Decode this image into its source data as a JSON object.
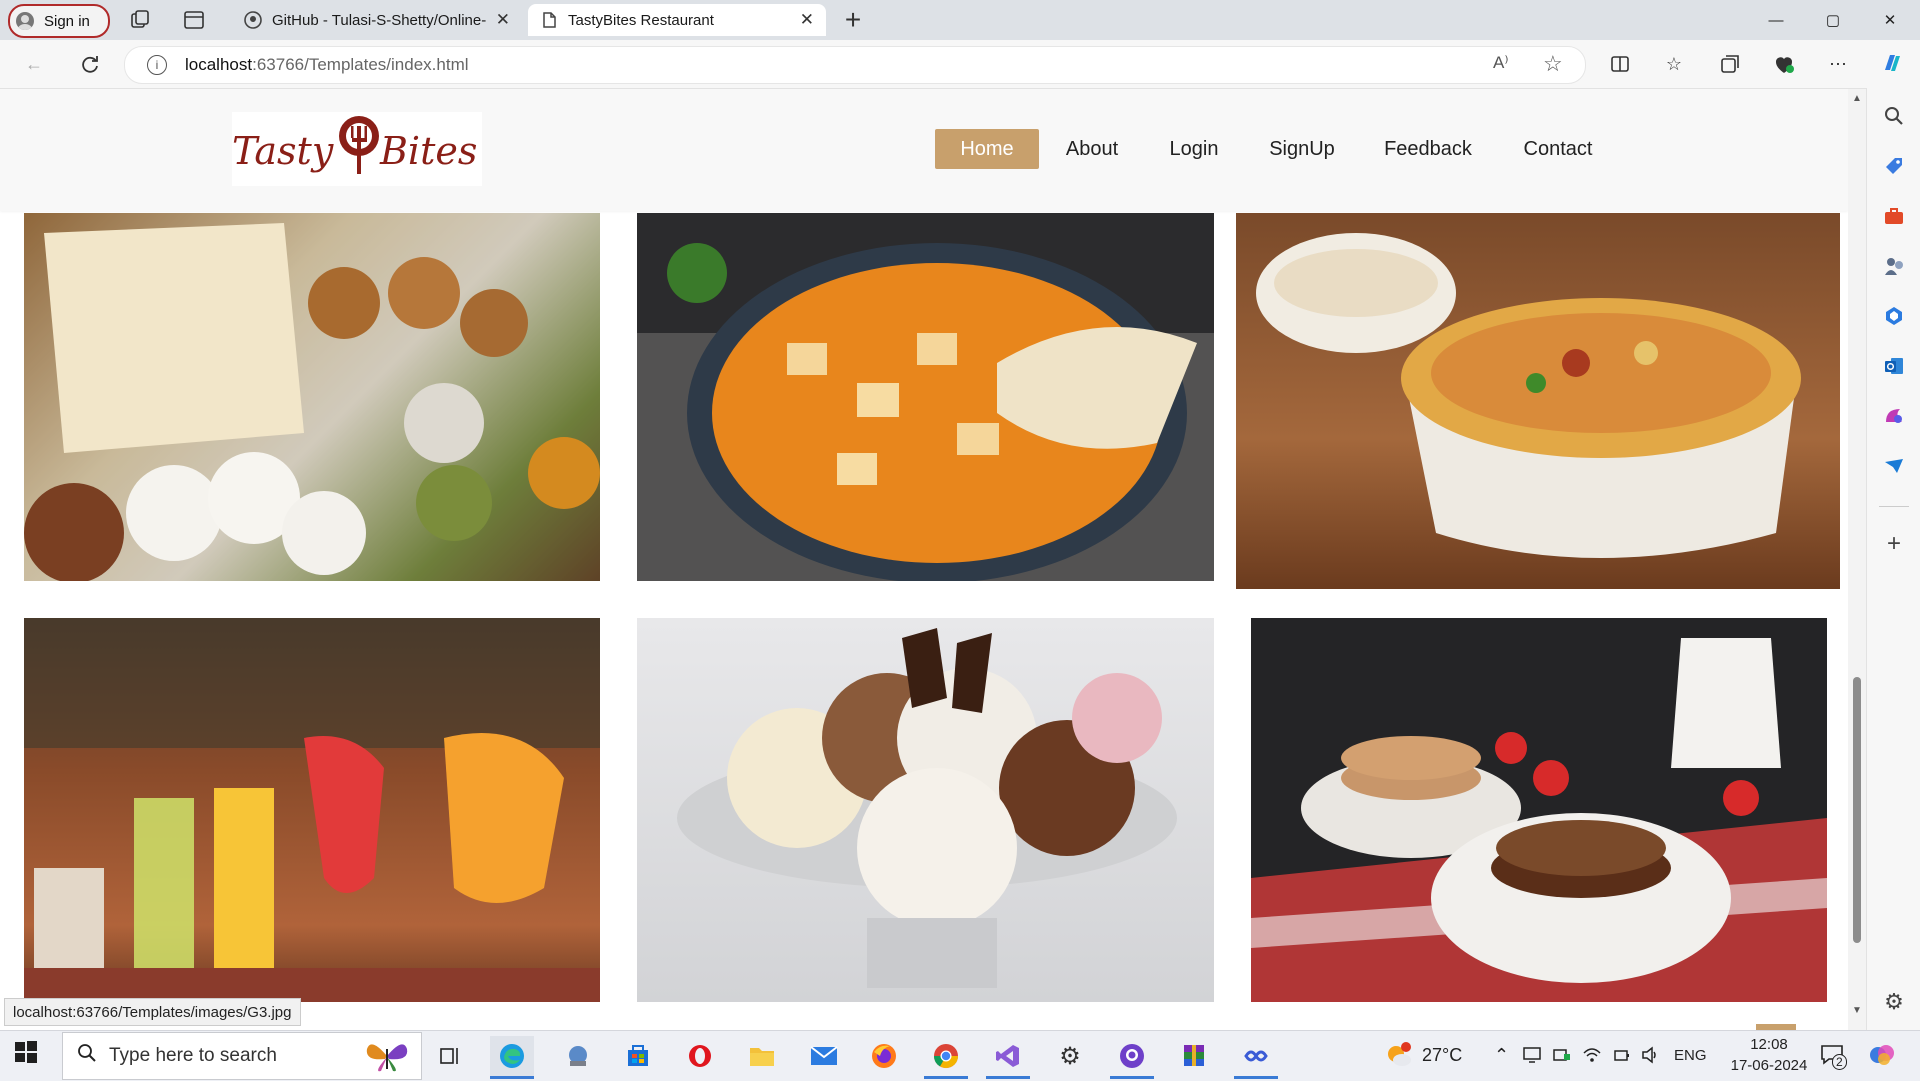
{
  "browser": {
    "profile_label": "Sign in",
    "tabs": [
      {
        "title": "GitHub - Tulasi-S-Shetty/Online-",
        "close": "✕"
      },
      {
        "title": "TastyBites Restaurant",
        "close": "✕"
      }
    ],
    "new_tab": "+",
    "window": {
      "minimize": "—",
      "maximize": "▢",
      "close": "✕"
    },
    "address": {
      "host": "localhost",
      "rest": ":63766/Templates/index.html"
    },
    "status_url": "localhost:63766/Templates/images/G3.jpg"
  },
  "site": {
    "logo_text_left": "Tasty",
    "logo_text_right": "Bites",
    "nav": [
      "Home",
      "About",
      "Login",
      "SignUp",
      "Feedback",
      "Contact"
    ],
    "active_nav": "Home",
    "accent": "#c8a06c",
    "back_to_top": "↑",
    "gallery": [
      {
        "alt": "South Indian breakfast"
      },
      {
        "alt": "Paneer curry with naan"
      },
      {
        "alt": "Biryani with raita"
      },
      {
        "alt": "Mocktails"
      },
      {
        "alt": "Ice cream sundae"
      },
      {
        "alt": "Chocolate pancakes"
      }
    ]
  },
  "taskbar": {
    "search_placeholder": "Type here to search",
    "weather": "27°C",
    "language": "ENG",
    "time": "12:08",
    "date": "17-06-2024",
    "notification_count": "2"
  }
}
